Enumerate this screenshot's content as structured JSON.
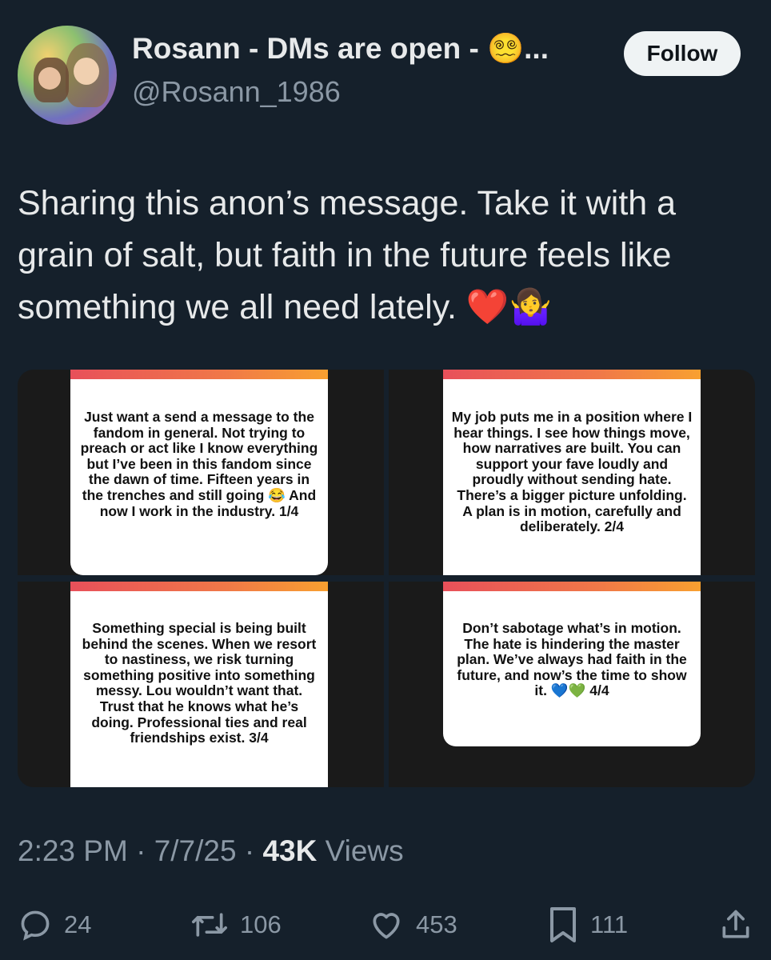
{
  "author": {
    "display_name": "Rosann - DMs are open - ",
    "name_emoji": "😵‍💫",
    "name_ellipsis": "...",
    "handle": "@Rosann_1986",
    "follow_label": "Follow"
  },
  "tweet": {
    "text": "Sharing this anon’s message. Take it with a grain of salt, but faith in the future feels like something we all need lately.",
    "emoji_heart": "❤️",
    "emoji_shrug": "🤷‍♀️"
  },
  "images": [
    {
      "text": "Just want a send a message to the fandom in general. Not trying to preach or act like I know everything but I’ve been in this fandom since the dawn of time. Fifteen years in the trenches and still going 😂 And now I work in the industry. 1/4"
    },
    {
      "text": "My job puts me in a position where I hear things. I see how things move, how narratives are built. You can support your fave loudly and proudly without sending hate. There’s a bigger picture unfolding. A plan is in motion, carefully and deliberately. 2/4"
    },
    {
      "text": "Something special is being built behind the scenes. When we resort to nastiness, we risk turning something positive into something messy. Lou wouldn’t want that. Trust that he knows what he’s doing. Professional ties and real friendships exist. 3/4"
    },
    {
      "text": "Don’t sabotage what’s in motion. The hate is hindering the master plan. We’ve always had faith in the future, and now’s the time to show it. 💙💚 4/4"
    }
  ],
  "meta": {
    "time": "2:23 PM",
    "sep": " · ",
    "date": "7/7/25",
    "views_count": "43K",
    "views_label": " Views"
  },
  "actions": {
    "replies": "24",
    "reposts": "106",
    "likes": "453",
    "bookmarks": "111"
  },
  "colors": {
    "background": "#15202b",
    "text": "#e7e9ea",
    "muted": "#8b98a5",
    "follow_bg": "#eff3f4"
  }
}
